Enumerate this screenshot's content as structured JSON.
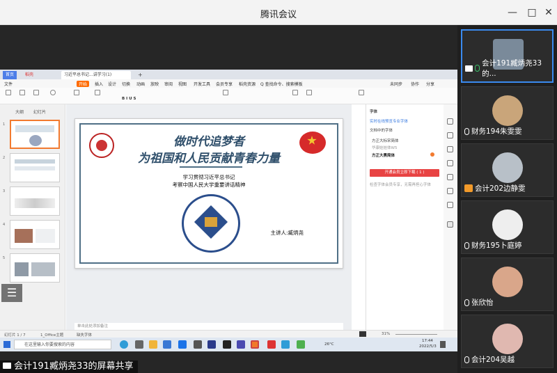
{
  "window": {
    "title": "腾讯会议",
    "controls": [
      "—",
      "□",
      "✕"
    ]
  },
  "share_caption": "会计191臧炳尧33的屏幕共享",
  "wps": {
    "tabs": [
      "首页",
      "稻壳",
      "习近平总书记...讲学习(1)"
    ],
    "menu": [
      "文件",
      "开始",
      "插入",
      "设计",
      "切换",
      "动画",
      "放映",
      "审阅",
      "视图",
      "开发工具",
      "会员专享",
      "稻壳资源",
      "Q 查找命令、搜索模板",
      "未同步",
      "协作",
      "分享"
    ],
    "thumb_tabs": [
      "大纲",
      "幻灯片"
    ],
    "slide": {
      "title_line1": "做时代追梦者",
      "title_line2": "为祖国和人民贡献青春力量",
      "subtitle_line1": "学习贯彻习近平总书记",
      "subtitle_line2": "考察中国人民大学重要讲话精神",
      "speaker": "主讲人:臧炳尧"
    },
    "notes_placeholder": "单击此处添加备注",
    "right_panel": {
      "title": "字体",
      "line1": "实时在线预览专业字体",
      "line2": "文档中的字体",
      "font_a": "方正大标宋简体",
      "font_b": "华康娃娃体W5",
      "font_c": "方正大黑简体",
      "button": "开通会员立即下载 ( 1 )",
      "note": "检查字体会员专享，无需再担心字体"
    },
    "status": {
      "slide_count": "幻灯片 1 / 7",
      "theme": "1_Office主题",
      "missing_font": "缺失字体",
      "zoom": "31%"
    }
  },
  "taskbar": {
    "search_placeholder": "在这里输入你要搜索的内容",
    "temperature": "26°C",
    "time": "17:44",
    "date": "2022/5/3"
  },
  "participants": [
    {
      "name": "会计191臧炳尧33的...",
      "avatar_color": "#7a8a9a",
      "active": true,
      "icon": "screen-share-icon",
      "mic_live": true
    },
    {
      "name": "财务194朱雯雯",
      "avatar_color": "#c9a57a",
      "active": false,
      "icon": "mic-icon",
      "mic_live": false
    },
    {
      "name": "会计202边静雯",
      "avatar_color": "#b8c0c8",
      "active": false,
      "icon": "wechat-icon",
      "mic_live": false
    },
    {
      "name": "财务195卜庭婷",
      "avatar_color": "#eeeeee",
      "active": false,
      "icon": "mic-icon",
      "mic_live": false
    },
    {
      "name": "张欣怡",
      "avatar_color": "#d9a68a",
      "active": false,
      "icon": "mic-icon",
      "mic_live": false
    },
    {
      "name": "会计204吴越",
      "avatar_color": "#e0b8b0",
      "active": false,
      "icon": "mic-icon",
      "mic_live": false
    }
  ]
}
